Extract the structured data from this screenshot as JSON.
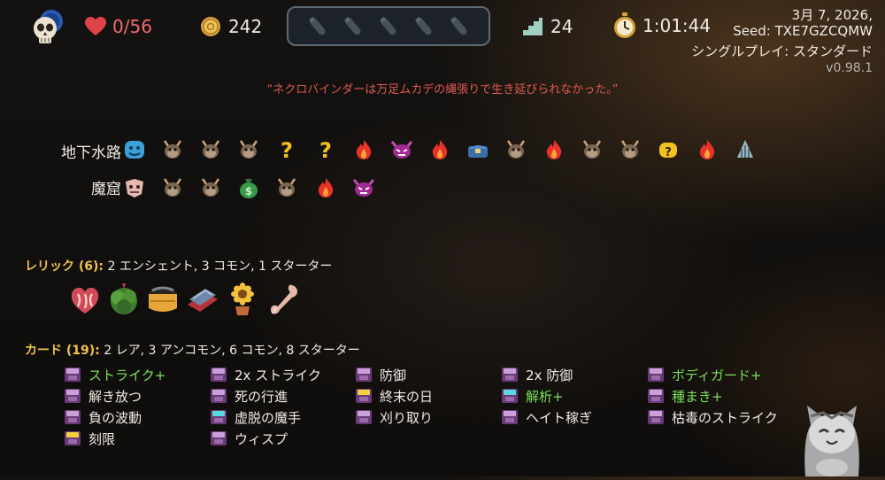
{
  "hud": {
    "hp": "0/56",
    "gold": "242",
    "floor": "24",
    "time": "1:01:44"
  },
  "meta": {
    "date": "3月 7, 2026,",
    "seed": "Seed: TXE7GZCQMW",
    "mode": "シングルプレイ: スタンダード",
    "version": "v0.98.1"
  },
  "death_message": "“ネクロバインダーは万足ムカデの縄張りで生き延びられなかった。”",
  "acts": [
    {
      "label": "地下水路",
      "nodes": [
        "ancient-icon",
        "monster-icon",
        "monster-icon",
        "monster-icon",
        "unknown-icon",
        "unknown-icon",
        "rest-icon",
        "elite-icon",
        "rest-icon",
        "treasure-icon",
        "monster-icon",
        "rest-icon",
        "monster-icon",
        "monster-icon",
        "unknown-icon",
        "rest-icon",
        "boss-icon"
      ]
    },
    {
      "label": "魔窟",
      "nodes": [
        "ancient-icon",
        "monster-icon",
        "monster-icon",
        "shop-icon",
        "monster-icon",
        "rest-icon",
        "elite-icon"
      ]
    }
  ],
  "relics": {
    "title": "レリック (6):",
    "summary": "2 エンシェント, 3 コモン, 1 スターター",
    "items": [
      "heart-relic-icon",
      "bush-relic-icon",
      "drum-relic-icon",
      "whetstone-relic-icon",
      "sunflower-relic-icon",
      "bone-relic-icon"
    ]
  },
  "cards": {
    "title": "カード (19):",
    "summary": "2 レア, 3 アンコモン, 6 コモン, 8 スターター",
    "columns": [
      [
        {
          "name": "ストライク+",
          "upgraded": true,
          "color": "#c9a0d8"
        },
        {
          "name": "解き放つ",
          "upgraded": false,
          "color": "#c9a0d8"
        },
        {
          "name": "負の波動",
          "upgraded": false,
          "color": "#c9a0d8"
        },
        {
          "name": "刻限",
          "upgraded": false,
          "color": "#f4d03f"
        }
      ],
      [
        {
          "name": "2x ストライク",
          "upgraded": false,
          "color": "#c9a0d8"
        },
        {
          "name": "死の行進",
          "upgraded": false,
          "color": "#c9a0d8"
        },
        {
          "name": "虚脱の魔手",
          "upgraded": false,
          "color": "#5ad8e0"
        },
        {
          "name": "ウィスプ",
          "upgraded": false,
          "color": "#c9a0d8"
        }
      ],
      [
        {
          "name": "防御",
          "upgraded": false,
          "color": "#c9a0d8"
        },
        {
          "name": "終末の日",
          "upgraded": false,
          "color": "#f4d03f"
        },
        {
          "name": "刈り取り",
          "upgraded": false,
          "color": "#c9a0d8"
        }
      ],
      [
        {
          "name": "2x 防御",
          "upgraded": false,
          "color": "#c9a0d8"
        },
        {
          "name": "解析+",
          "upgraded": true,
          "color": "#5ad8e0"
        },
        {
          "name": "ヘイト稼ぎ",
          "upgraded": false,
          "color": "#c9a0d8"
        }
      ],
      [
        {
          "name": "ボディガード+",
          "upgraded": true,
          "color": "#c9a0d8"
        },
        {
          "name": "種まき+",
          "upgraded": true,
          "color": "#c9a0d8"
        },
        {
          "name": "枯毒のストライク",
          "upgraded": false,
          "color": "#c9a0d8"
        }
      ]
    ]
  }
}
